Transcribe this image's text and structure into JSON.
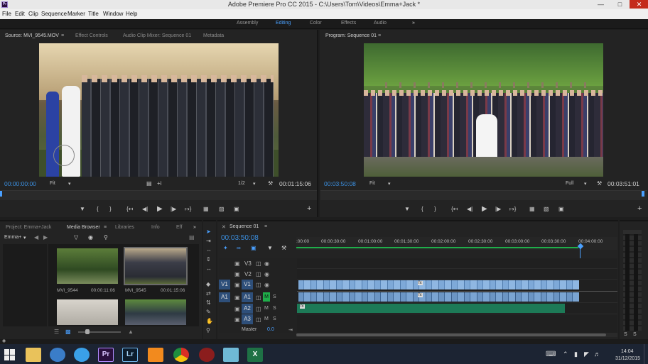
{
  "window": {
    "title": "Adobe Premiere Pro CC 2015 - C:\\Users\\Tom\\Videos\\Emma+Jack *",
    "app_icon": "Pr"
  },
  "menu": [
    "File",
    "Edit",
    "Clip",
    "Sequence",
    "Marker",
    "Title",
    "Window",
    "Help"
  ],
  "workspaces": [
    "Assembly",
    "Editing",
    "Color",
    "Effects",
    "Audio"
  ],
  "active_workspace": "Editing",
  "source_panel": {
    "tabs": [
      "Source: MVI_9545.MOV",
      "Effect Controls",
      "Audio Clip Mixer: Sequence 01",
      "Metadata"
    ],
    "timecode": "00:00:00:00",
    "fit": "Fit",
    "resolution": "1/2",
    "duration": "00:01:15:06"
  },
  "program_panel": {
    "tab": "Program: Sequence 01",
    "timecode": "00:03:50:08",
    "fit": "Fit",
    "resolution": "Full",
    "duration": "00:03:51:01"
  },
  "project_panel": {
    "tabs": [
      "Project: Emma+Jack",
      "Media Browser",
      "Libraries",
      "Info",
      "Eff"
    ],
    "active_tab": "Media Browser",
    "location": "Emma+",
    "items": [
      {
        "name": "MVI_9544",
        "duration": "00:00:11:06"
      },
      {
        "name": "MVI_9545",
        "duration": "00:01:15:06"
      }
    ]
  },
  "timeline": {
    "tab": "Sequence 01",
    "timecode": "00:03:50:08",
    "ruler": [
      ":00:00",
      "00:00:30:00",
      "00:01:00:00",
      "00:01:30:00",
      "00:02:00:00",
      "00:02:30:00",
      "00:03:00:00",
      "00:03:30:00",
      "00:04:00:00"
    ],
    "video_tracks": [
      "V3",
      "V2",
      "V1"
    ],
    "audio_tracks": [
      "A1",
      "A2",
      "A3"
    ],
    "source_patch_v": "V1",
    "source_patch_a": "A1",
    "mute": "M",
    "solo": "S",
    "master_label": "Master",
    "master_value": "0.0",
    "fx_badge": "fx"
  },
  "meter": {
    "labels": [
      "S",
      "S"
    ]
  },
  "taskbar": {
    "time": "14:04",
    "date": "31/12/2015",
    "apps": [
      "Pr",
      "Lr",
      "X"
    ]
  },
  "colors": {
    "accent": "#3b8fe0",
    "video_clip": "#7aa7d9",
    "audio_clip": "#1d7a57",
    "playhead": "#4aa0ff"
  }
}
